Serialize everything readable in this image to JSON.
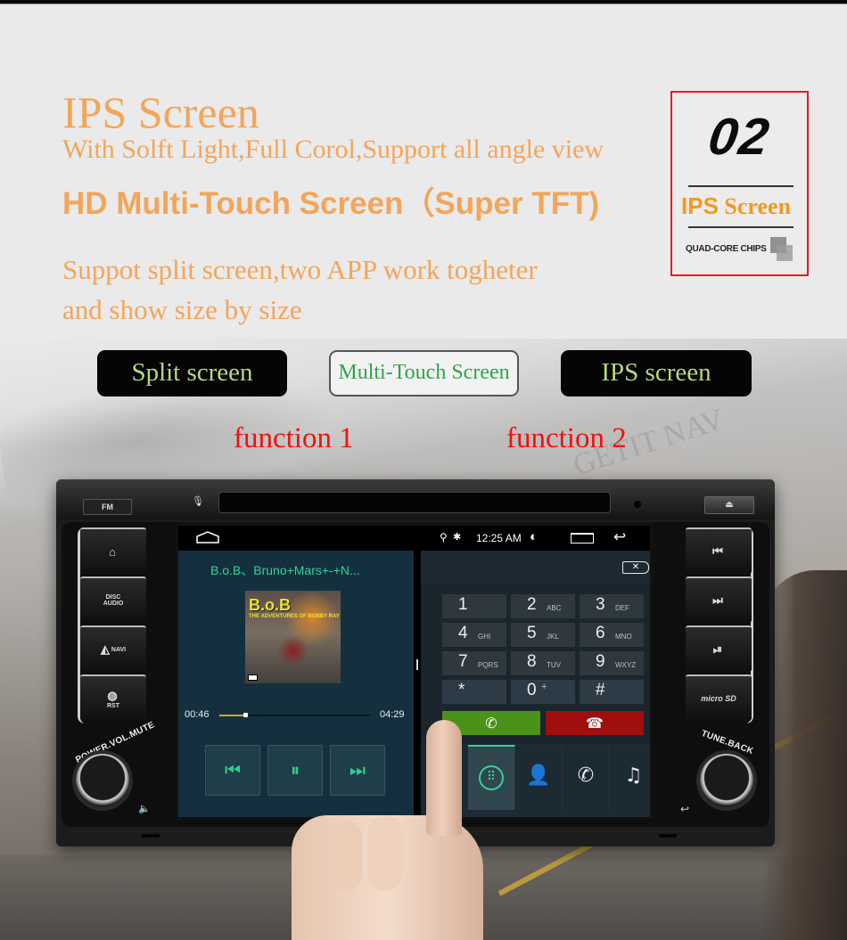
{
  "headline": {
    "title": "IPS Screen",
    "subtitle": "With Solft Light,Full Corol,Support all angle view",
    "hd_line": "HD Multi-Touch Screen（Super TFT)",
    "split_line_1": "Suppot split screen,two APP work togheter",
    "split_line_2": "and show size by size"
  },
  "badge": {
    "number": "02",
    "title_prefix": "IPS",
    "title_suffix": " Screen",
    "footer": "QUAD-CORE CHIPS",
    "border_color": "#e31d1d"
  },
  "features": [
    {
      "label": "Split screen"
    },
    {
      "label": "Multi-Touch Screen"
    },
    {
      "label": "IPS screen"
    }
  ],
  "functions": [
    "function 1",
    "function 2"
  ],
  "watermark": "GETIT NAV",
  "device": {
    "fm_label": "FM",
    "eject_icon": "⏏",
    "left_buttons": [
      {
        "icon": "home-icon",
        "glyph": "⌂",
        "label": ""
      },
      {
        "icon": "disc-icon",
        "glyph": "",
        "label": "DISC",
        "sub": "AUDIO"
      },
      {
        "icon": "navi-icon",
        "glyph": "◭",
        "label": "NAVI"
      },
      {
        "icon": "globe-icon",
        "glyph": "◍",
        "label": "RST"
      }
    ],
    "right_buttons": [
      {
        "icon": "previous-track-icon",
        "glyph": "⏮"
      },
      {
        "icon": "next-track-icon",
        "glyph": "⏭"
      },
      {
        "icon": "play-pause-icon",
        "glyph": "⏯"
      },
      {
        "icon": "microsd-icon",
        "glyph": "",
        "label": "micro SD"
      }
    ],
    "left_knob_label": "POWER.VOL.MUTE",
    "right_knob_label": "TUNE.BACK",
    "mute_glyph": "🔈",
    "back_glyph": "↩"
  },
  "statusbar": {
    "time": "12:25 AM",
    "location_glyph": "⬤",
    "bluetooth_glyph": "✱",
    "brightness_glyph": "◐",
    "back_glyph": "↩"
  },
  "music": {
    "title": "B.o.B、Bruno+Mars+-+N...",
    "album_art_text": "B.o.B",
    "album_art_sub": "THE ADVENTURES OF BOBBY RAY",
    "current_time": "00:46",
    "total_time": "04:29",
    "progress": 0.171,
    "controls": [
      {
        "name": "previous",
        "glyph": "⏮"
      },
      {
        "name": "pause",
        "glyph": "⏸"
      },
      {
        "name": "next",
        "glyph": "⏭"
      }
    ],
    "accent_color": "#34d29a"
  },
  "dialer": {
    "backspace_glyph": "✕",
    "keys": [
      {
        "digit": "1",
        "letters": ""
      },
      {
        "digit": "2",
        "letters": "ABC"
      },
      {
        "digit": "3",
        "letters": "DEF"
      },
      {
        "digit": "4",
        "letters": "GHI"
      },
      {
        "digit": "5",
        "letters": "JKL"
      },
      {
        "digit": "6",
        "letters": "MNO"
      },
      {
        "digit": "7",
        "letters": "PQRS"
      },
      {
        "digit": "8",
        "letters": "TUV"
      },
      {
        "digit": "9",
        "letters": "WXYZ"
      },
      {
        "digit": "*",
        "letters": ""
      },
      {
        "digit": "0",
        "letters": "+"
      },
      {
        "digit": "#",
        "letters": ""
      }
    ],
    "call_glyph": "✆",
    "end_glyph": "☎",
    "call_color": "#4a9219",
    "end_color": "#a10e0e",
    "tabs": [
      {
        "name": "keypad",
        "glyph": "⠿",
        "active": true
      },
      {
        "name": "contacts",
        "glyph": "👤",
        "active": false
      },
      {
        "name": "call-log",
        "glyph": "✆",
        "active": false
      },
      {
        "name": "music",
        "glyph": "♫",
        "active": false
      }
    ]
  }
}
